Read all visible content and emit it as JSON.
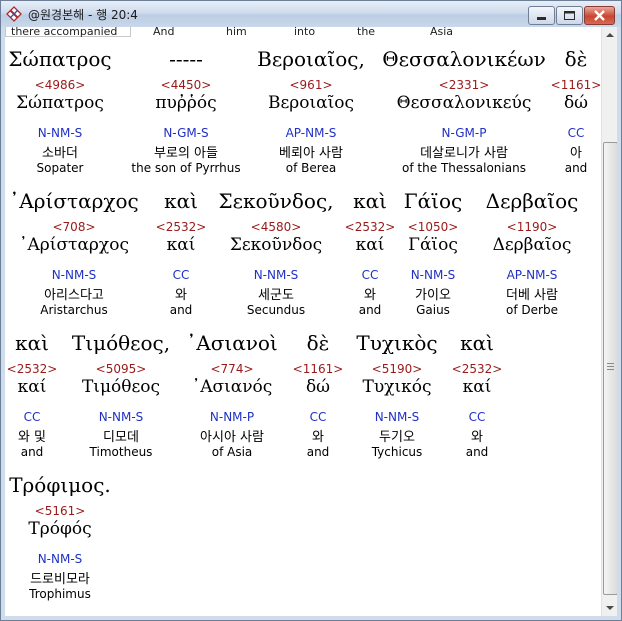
{
  "window": {
    "title": "@원경본해 - 행 20:4",
    "buttons": {
      "minimize": "minimize",
      "maximize": "maximize",
      "close": "close"
    }
  },
  "partial_row": [
    "there accompanied",
    "And",
    "him",
    "into",
    "the",
    "Asia"
  ],
  "rows": [
    {
      "words": [
        {
          "greek": "Σώπατρος",
          "num": "<4986>",
          "lemma": "Σώπατρος",
          "parse": "N-NM-S",
          "kor": "소바더",
          "eng": "Sopater"
        },
        {
          "greek": "-----",
          "num": "<4450>",
          "lemma": "πυῤῥός",
          "parse": "N-GM-S",
          "kor": "부로의 아들",
          "eng": "the son of Pyrrhus"
        },
        {
          "greek": "Βεροιαῖος,",
          "num": "<961>",
          "lemma": "Βεροιαῖος",
          "parse": "AP-NM-S",
          "kor": "베뢰아 사람",
          "eng": "of Berea"
        },
        {
          "greek": "Θεσσαλονικέων",
          "num": "<2331>",
          "lemma": "Θεσσαλονικεύς",
          "parse": "N-GM-P",
          "kor": "데살로니가 사람",
          "eng": "of the Thessalonians"
        },
        {
          "greek": "δὲ",
          "num": "<1161>",
          "lemma": "δώ",
          "parse": "CC",
          "kor": "아",
          "eng": "and"
        }
      ]
    },
    {
      "words": [
        {
          "greek": "᾿Αρίσταρχος",
          "num": "<708>",
          "lemma": "᾿Αρίσταρχος",
          "parse": "N-NM-S",
          "kor": "아리스다고",
          "eng": "Aristarchus"
        },
        {
          "greek": "καὶ",
          "num": "<2532>",
          "lemma": "καί",
          "parse": "CC",
          "kor": "와",
          "eng": "and"
        },
        {
          "greek": "Σεκοῦνδος,",
          "num": "<4580>",
          "lemma": "Σεκοῦνδος",
          "parse": "N-NM-S",
          "kor": "세군도",
          "eng": "Secundus"
        },
        {
          "greek": "καὶ",
          "num": "<2532>",
          "lemma": "καί",
          "parse": "CC",
          "kor": "와",
          "eng": "and"
        },
        {
          "greek": "Γάϊος",
          "num": "<1050>",
          "lemma": "Γάϊος",
          "parse": "N-NM-S",
          "kor": "가이오",
          "eng": "Gaius"
        },
        {
          "greek": "Δερβαῖος",
          "num": "<1190>",
          "lemma": "Δερβαῖος",
          "parse": "AP-NM-S",
          "kor": "더베 사람",
          "eng": "of Derbe"
        }
      ]
    },
    {
      "words": [
        {
          "greek": "καὶ",
          "num": "<2532>",
          "lemma": "καί",
          "parse": "CC",
          "kor": "와 및",
          "eng": "and"
        },
        {
          "greek": "Τιμόθεος,",
          "num": "<5095>",
          "lemma": "Τιμόθεος",
          "parse": "N-NM-S",
          "kor": "디모데",
          "eng": "Timotheus"
        },
        {
          "greek": "᾿Ασιανοὶ",
          "num": "<774>",
          "lemma": "᾿Ασιανός",
          "parse": "N-NM-P",
          "kor": "아시아 사람",
          "eng": "of Asia"
        },
        {
          "greek": "δὲ",
          "num": "<1161>",
          "lemma": "δώ",
          "parse": "CC",
          "kor": "와",
          "eng": "and"
        },
        {
          "greek": "Τυχικὸς",
          "num": "<5190>",
          "lemma": "Τυχικός",
          "parse": "N-NM-S",
          "kor": "두기오",
          "eng": "Tychicus"
        },
        {
          "greek": "καὶ",
          "num": "<2532>",
          "lemma": "καί",
          "parse": "CC",
          "kor": "와",
          "eng": "and"
        }
      ]
    },
    {
      "words": [
        {
          "greek": "Τρόφιμος.",
          "num": "<5161>",
          "lemma": "Τρόφός",
          "parse": "N-NM-S",
          "kor": "드로비모라",
          "eng": "Trophimus"
        }
      ]
    }
  ]
}
